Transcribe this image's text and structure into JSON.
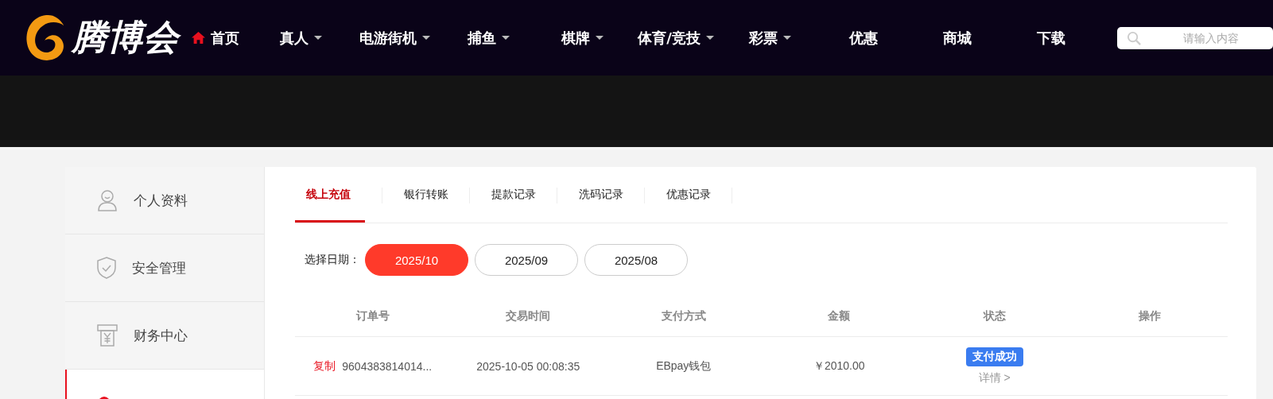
{
  "logo": {
    "text": "腾博会"
  },
  "nav": [
    {
      "label": "首页",
      "kind": "home"
    },
    {
      "label": "真人",
      "kind": "dropdown"
    },
    {
      "label": "电游街机",
      "kind": "dropdown"
    },
    {
      "label": "捕鱼",
      "kind": "dropdown"
    },
    {
      "label": "棋牌",
      "kind": "dropdown"
    },
    {
      "label": "体育/竞技",
      "kind": "dropdown"
    },
    {
      "label": "彩票",
      "kind": "dropdown"
    },
    {
      "label": "优惠",
      "kind": "link"
    },
    {
      "label": "商城",
      "kind": "link"
    },
    {
      "label": "下载",
      "kind": "link"
    }
  ],
  "search": {
    "placeholder": "请输入内容"
  },
  "sidebar": {
    "items": [
      {
        "label": "个人资料",
        "kind": "user",
        "selected": false
      },
      {
        "label": "安全管理",
        "kind": "shield",
        "selected": false
      },
      {
        "label": "财务中心",
        "kind": "finance",
        "selected": false
      },
      {
        "kind": "partial",
        "selected": true
      }
    ]
  },
  "tabs": [
    {
      "label": "线上充值",
      "selected": true
    },
    {
      "label": "银行转账",
      "selected": false
    },
    {
      "label": "提款记录",
      "selected": false
    },
    {
      "label": "洗码记录",
      "selected": false
    },
    {
      "label": "优惠记录",
      "selected": false
    }
  ],
  "date_filter": {
    "label": "选择日期：",
    "options": [
      {
        "label": "2025/10",
        "selected": true
      },
      {
        "label": "2025/09",
        "selected": false
      },
      {
        "label": "2025/08",
        "selected": false
      }
    ]
  },
  "table": {
    "columns": [
      "订单号",
      "交易时间",
      "支付方式",
      "金额",
      "状态",
      "操作"
    ],
    "rows": [
      {
        "copy": "复制",
        "order": "9604383814014...",
        "time": "2025-10-05 00:08:35",
        "method": "EBpay钱包",
        "amount": "￥2010.00",
        "status": "支付成功",
        "details": "详情 >"
      }
    ]
  }
}
